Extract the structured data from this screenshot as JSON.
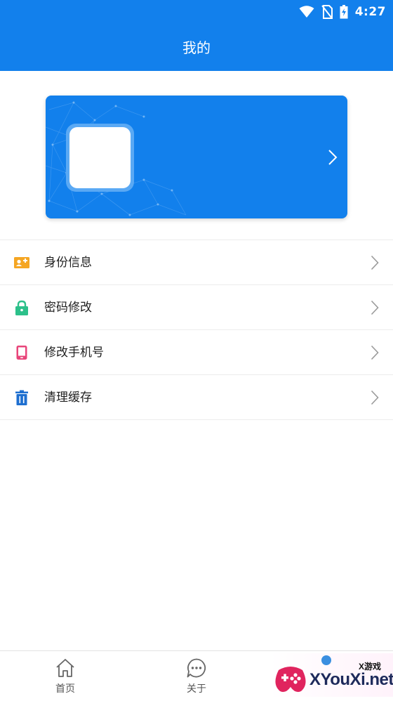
{
  "status_bar": {
    "time": "4:27"
  },
  "header": {
    "title": "我的"
  },
  "menu": {
    "items": [
      {
        "label": "身份信息",
        "icon": "id-card-icon",
        "color": "#f5a623"
      },
      {
        "label": "密码修改",
        "icon": "lock-icon",
        "color": "#2cc08a"
      },
      {
        "label": "修改手机号",
        "icon": "phone-icon",
        "color": "#e8457a"
      },
      {
        "label": "清理缓存",
        "icon": "trash-icon",
        "color": "#1e6fd0"
      }
    ]
  },
  "tabbar": {
    "tabs": [
      {
        "label": "首页",
        "icon": "home-icon"
      },
      {
        "label": "关于",
        "icon": "chat-icon"
      }
    ]
  },
  "watermark": {
    "brand": "XYouXi.net",
    "tag": "X游戏"
  },
  "colors": {
    "primary": "#1280ec",
    "divider": "#ececec"
  }
}
